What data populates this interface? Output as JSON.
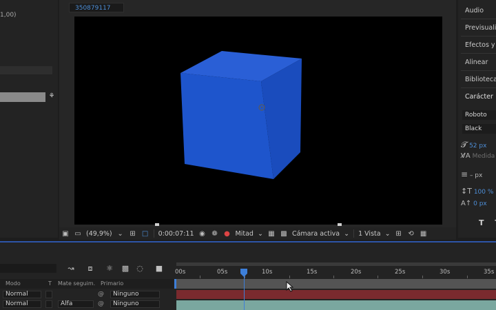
{
  "left_panel": {
    "coord_text": "1,00)"
  },
  "viewer": {
    "comp_tab": "350879117",
    "zoom": "(49,9%)",
    "timecode": "0:00:07:11",
    "resolution": "Mitad",
    "camera": "Cámara activa",
    "views": "1 Vista"
  },
  "right_panel": {
    "panels": [
      "Audio",
      "Previsualiz",
      "Efectos y a",
      "Alinear",
      "Bibliotecas",
      "Carácter"
    ],
    "font_family": "Roboto",
    "font_style": "Black",
    "font_size": "52 px",
    "kerning": "Medida",
    "leading": "– px",
    "vertical_scale": "100 %",
    "baseline_shift": "0 px"
  },
  "timeline": {
    "columns": {
      "mode": "Modo",
      "t": "T",
      "track_matte": "Mate seguim.",
      "parent": "Primario"
    },
    "layers": [
      {
        "mode": "Normal",
        "matte": "",
        "parent": "Ninguno"
      },
      {
        "mode": "Normal",
        "matte": "Alfa",
        "parent": "Ninguno"
      }
    ],
    "ruler_labels": [
      "00s",
      "05s",
      "10s",
      "15s",
      "20s",
      "25s",
      "30s",
      "35s"
    ]
  },
  "colors": {
    "cube_front": "#1e55cc",
    "accent_blue": "#3d7fd9",
    "track_red": "#7a2a2e",
    "track_teal": "#7aa79f"
  }
}
